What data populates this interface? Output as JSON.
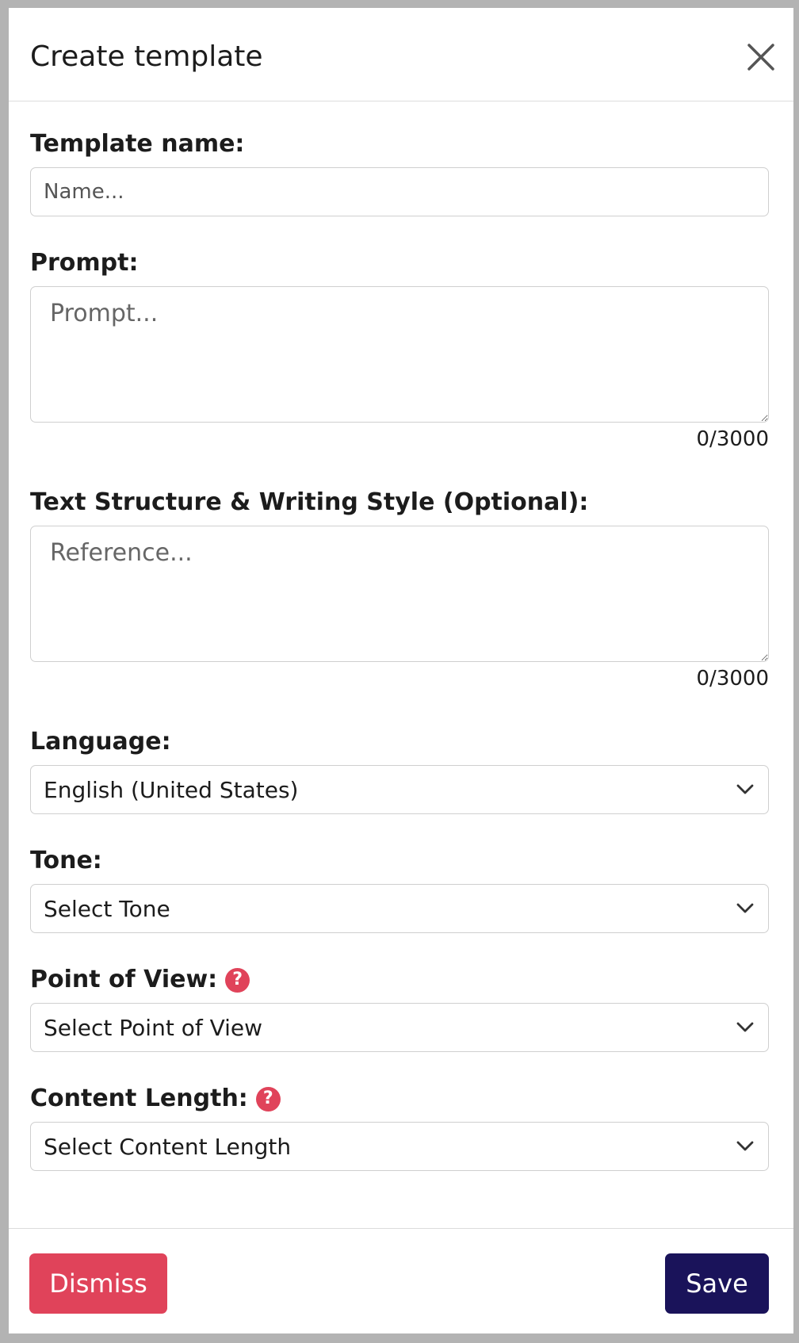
{
  "modal": {
    "title": "Create template"
  },
  "fields": {
    "template_name": {
      "label": "Template name:",
      "placeholder": "Name...",
      "value": ""
    },
    "prompt": {
      "label": "Prompt:",
      "placeholder": "Prompt...",
      "value": "",
      "counter": "0/3000"
    },
    "reference": {
      "label": "Text Structure & Writing Style (Optional):",
      "placeholder": "Reference...",
      "value": "",
      "counter": "0/3000"
    },
    "language": {
      "label": "Language:",
      "selected": "English (United States)"
    },
    "tone": {
      "label": "Tone:",
      "selected": "Select Tone"
    },
    "point_of_view": {
      "label": "Point of View:",
      "selected": "Select Point of View",
      "help_icon": "?"
    },
    "content_length": {
      "label": "Content Length:",
      "selected": "Select Content Length",
      "help_icon": "?"
    }
  },
  "footer": {
    "dismiss_label": "Dismiss",
    "save_label": "Save"
  },
  "colors": {
    "danger": "#e0435a",
    "primary": "#1a135a",
    "border": "#cfcfcf"
  },
  "icons": {
    "close": "close-icon",
    "chevron": "chevron-down-icon",
    "help": "question-circle-icon"
  }
}
